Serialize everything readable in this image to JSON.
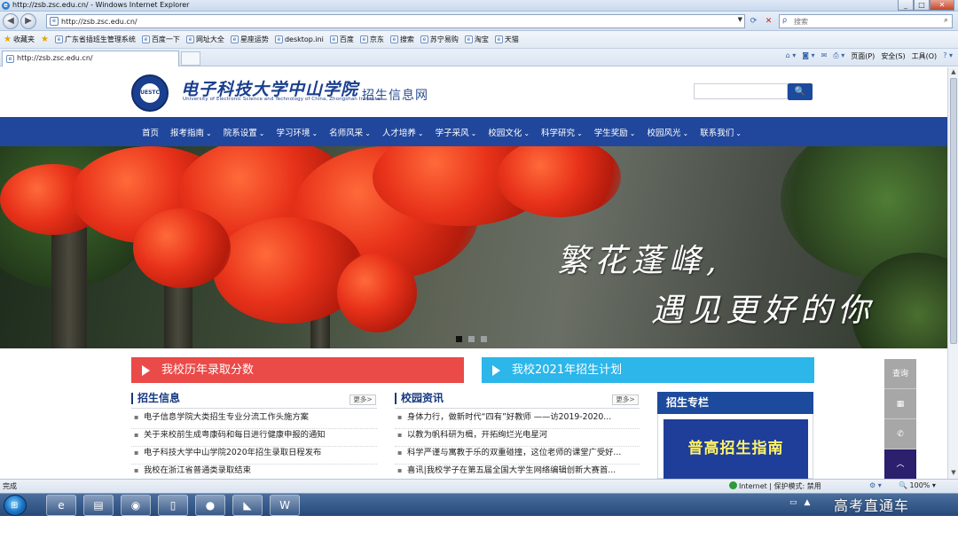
{
  "ie": {
    "window_title": "http://zsb.zsc.edu.cn/ - Windows Internet Explorer",
    "address": "http://zsb.zsc.edu.cn/",
    "search_placeholder": "搜索",
    "favorites_label": "收藏夹",
    "favorites": [
      "广东省插班生管理系统",
      "百度一下",
      "网址大全",
      "星座运势",
      "desktop.ini",
      "百度",
      "京东",
      "搜索",
      "苏宁易购",
      "淘宝",
      "天猫"
    ],
    "tab_title": "http://zsb.zsc.edu.cn/",
    "cmd": {
      "page": "页面(P)",
      "safety": "安全(S)",
      "tools": "工具(O)"
    },
    "status_left": "完成",
    "status_zone": "Internet | 保护模式: 禁用",
    "status_zoom": "100%"
  },
  "site": {
    "logo_cn": "电子科技大学中山学院",
    "logo_en": "University of Electronic Science and Technology of China, Zhongshan Institute",
    "logo_sub": "招生信息网",
    "seal_text": "UESTC",
    "search_button": "🔍",
    "nav": [
      {
        "label": "首页",
        "dropdown": false
      },
      {
        "label": "报考指南",
        "dropdown": true
      },
      {
        "label": "院系设置",
        "dropdown": true
      },
      {
        "label": "学习环境",
        "dropdown": true
      },
      {
        "label": "名师风采",
        "dropdown": true
      },
      {
        "label": "人才培养",
        "dropdown": true
      },
      {
        "label": "学子采风",
        "dropdown": true
      },
      {
        "label": "校园文化",
        "dropdown": true
      },
      {
        "label": "科学研究",
        "dropdown": true
      },
      {
        "label": "学生奖励",
        "dropdown": true
      },
      {
        "label": "校园风光",
        "dropdown": true
      },
      {
        "label": "联系我们",
        "dropdown": true
      }
    ],
    "banner": {
      "line1": "繁花蓬峰,",
      "line2": "遇见更好的你",
      "slide_active": 1,
      "slide_count": 3
    },
    "bar_left": "我校历年录取分数",
    "bar_right": "我校2021年招生计划",
    "more_label": "更多>",
    "sec_zsxx": {
      "title": "招生信息",
      "items": [
        "电子信息学院大类招生专业分流工作头施方案",
        "关于来校前生成粤康码和每日进行健康申报的通知",
        "电子科技大学中山学院2020年招生录取日程发布",
        "我校在浙江省普通类录取结束"
      ]
    },
    "sec_xyzx": {
      "title": "校园资讯",
      "items": [
        "身体力行，做新时代“四有”好教师 ——访2019-2020...",
        "以教为帆科研为楫，开拓绚烂光电星河",
        "科学严谨与寓教于乐的双重碰撞，这位老师的课堂广受好...",
        "喜讯|我校学子在第五届全国大学生网络编辑创新大赛首..."
      ]
    },
    "zhuanlan": {
      "title": "招生专栏",
      "card": "普高招生指南"
    },
    "float": {
      "query": "查询"
    }
  },
  "overlay": {
    "watermark": "高考直通车"
  }
}
